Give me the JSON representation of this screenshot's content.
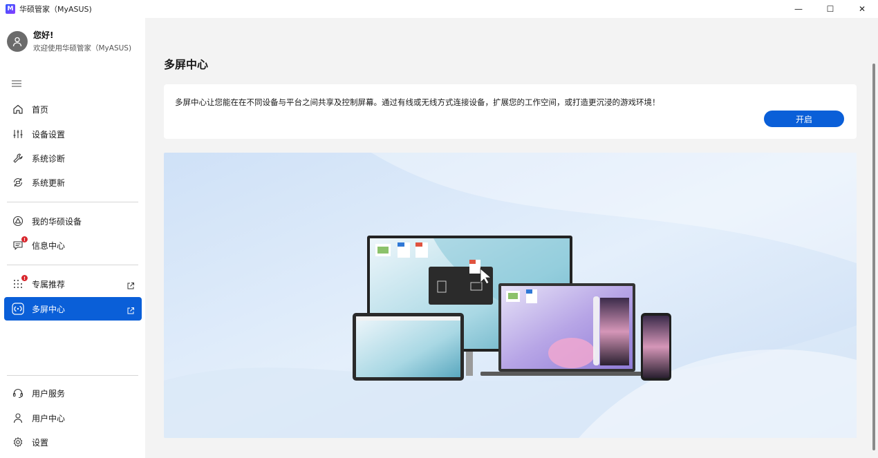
{
  "window": {
    "title": "华硕管家（MyASUS)",
    "logo_letter": "M",
    "controls": {
      "minimize": "—",
      "maximize": "☐",
      "close": "✕"
    }
  },
  "profile": {
    "greeting": "您好!",
    "welcome": "欢迎使用华硕管家（MyASUS)"
  },
  "sidebar": {
    "items": [
      {
        "label": "首页",
        "icon": "home-icon"
      },
      {
        "label": "设备设置",
        "icon": "sliders-icon"
      },
      {
        "label": "系统诊断",
        "icon": "wrench-icon"
      },
      {
        "label": "系统更新",
        "icon": "update-icon"
      },
      {
        "label": "我的华硕设备",
        "icon": "device-triangle-icon"
      },
      {
        "label": "信息中心",
        "icon": "message-icon",
        "badge": "!"
      },
      {
        "label": "专属推荐",
        "icon": "recommend-icon",
        "badge": "!",
        "external": true
      },
      {
        "label": "多屏中心",
        "icon": "multiscreen-icon",
        "external": true,
        "active": true
      },
      {
        "label": "用户服务",
        "icon": "headset-icon"
      },
      {
        "label": "用户中心",
        "icon": "user-icon"
      },
      {
        "label": "设置",
        "icon": "gear-icon"
      }
    ]
  },
  "main": {
    "title": "多屏中心",
    "description": "多屏中心让您能在在不同设备与平台之间共享及控制屏幕。通过有线或无线方式连接设备，扩展您的工作空间，或打造更沉浸的游戏环境！",
    "enable_label": "开启"
  },
  "colors": {
    "accent": "#0a5fd8",
    "badge": "#d8262c",
    "sidebar_bg": "#ffffff",
    "main_bg": "#f3f3f3"
  }
}
